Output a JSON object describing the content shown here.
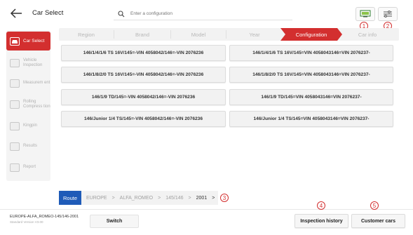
{
  "header": {
    "title": "Car Select",
    "search_placeholder": "Enter a configuration"
  },
  "callouts": [
    "1",
    "2",
    "3",
    "4",
    "5"
  ],
  "sidebar": {
    "items": [
      {
        "label": "Car Select",
        "icon": "car-icon",
        "active": true
      },
      {
        "label": "Vehicle Inspection",
        "icon": "inspection-icon",
        "active": false
      },
      {
        "label": "Measurem ent",
        "icon": "measurement-icon",
        "active": false
      },
      {
        "label": "Rolling Compress tion",
        "icon": "rolling-icon",
        "active": false
      },
      {
        "label": "Kingpin",
        "icon": "kingpin-icon",
        "active": false
      },
      {
        "label": "Results",
        "icon": "results-icon",
        "active": false
      },
      {
        "label": "Report",
        "icon": "report-icon",
        "active": false
      }
    ]
  },
  "steps": [
    {
      "label": "Region",
      "active": false
    },
    {
      "label": "Brand",
      "active": false
    },
    {
      "label": "Model",
      "active": false
    },
    {
      "label": "Year",
      "active": false
    },
    {
      "label": "Configuration",
      "active": true
    },
    {
      "label": "Car info",
      "active": false
    }
  ],
  "configurations": [
    "146/1/4/1/6 TS 16V/145=-VIN 4058042/146=-VIN 2076236",
    "146/1/4/1/6 TS 16V/145=VIN 4058043146=VIN 2076237-",
    "146/1/8/2/0 TS 16V/145=-VIN 4058042/146=-VIN 2076236",
    "146/1/8/2/0 TS 16V/145=VIN 4058043146=VIN 2076237-",
    "146/1/9 TD/145=-VIN 4058042/146=-VIN 2076236",
    "146/1/9 TD/145=VIN 4058043146=VIN 2076237-",
    "146/Junior 1/4 TS/145=-VIN 4058042/146=-VIN 2076236",
    "146/Junior 1/4 TS/145=VIN 4058043146=VIN 2076237-"
  ],
  "breadcrumb": {
    "route_label": "Route",
    "items": [
      "EUROPE",
      "ALFA_ROMEO",
      "145/146",
      "2001"
    ],
    "separator": ">"
  },
  "footer": {
    "vehicle_path": "EUROPE-ALFA_ROMEO-145/146-2001",
    "version_text": "Standard Version V3.00",
    "switch_label": "Switch",
    "inspection_history_label": "Inspection history",
    "customer_cars_label": "Customer cars"
  },
  "colors": {
    "accent_red": "#d32f2f",
    "route_blue": "#1f5bb8"
  }
}
